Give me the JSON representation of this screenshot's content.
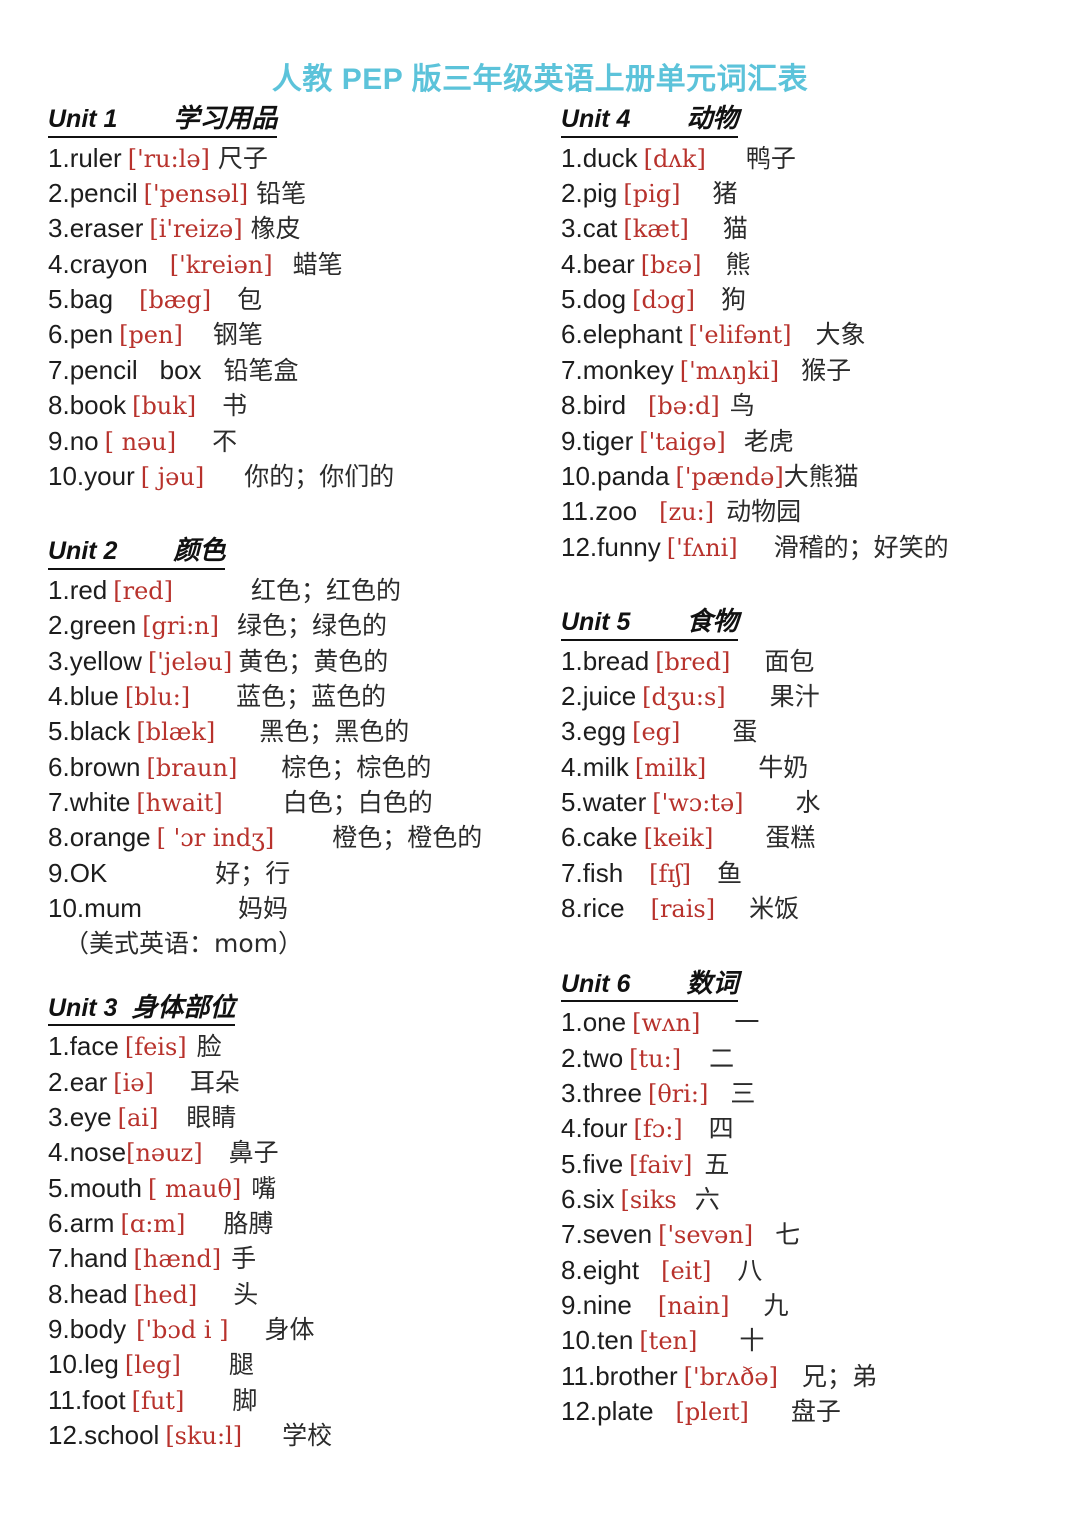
{
  "document": {
    "title": "人教 PEP 版三年级英语上册单元词汇表",
    "title_color": "#5cc3da",
    "phonetic_color": "#b8322c",
    "text_color": "#1a1a1a",
    "background": "#ffffff"
  },
  "units": [
    {
      "id": "unit-1",
      "label": "Unit 1",
      "topic": "学习用品",
      "gap": 56,
      "column": "left",
      "entries": [
        {
          "num": "1.",
          "word": "ruler",
          "gap1": 6,
          "phon": "['ru:lə]",
          "gap2": 8,
          "zh": "尺子"
        },
        {
          "num": "2.",
          "word": "pencil",
          "gap1": 6,
          "phon": "['pensəl]",
          "gap2": 8,
          "zh": "铅笔"
        },
        {
          "num": "3.",
          "word": "eraser",
          "gap1": 6,
          "phon": "[i'reizə]",
          "gap2": 8,
          "zh": "橡皮"
        },
        {
          "num": "4.",
          "word": "crayon",
          "gap1": 22,
          "phon": "['kreiən]",
          "gap2": 20,
          "zh": "蜡笔"
        },
        {
          "num": "5.",
          "word": "bag",
          "gap1": 26,
          "phon": "[bæg]",
          "gap2": 26,
          "zh": "包"
        },
        {
          "num": "6.",
          "word": "pen",
          "gap1": 6,
          "phon": "[pen]",
          "gap2": 30,
          "zh": "钢笔"
        },
        {
          "num": "7.",
          "word": "pencil",
          "gap1": 22,
          "phon": "box",
          "gap2": 22,
          "zh": "铅笔盒",
          "plain": true
        },
        {
          "num": "8.",
          "word": "book",
          "gap1": 6,
          "phon": "[buk]",
          "gap2": 26,
          "zh": "书"
        },
        {
          "num": "9.",
          "word": "no",
          "gap1": 6,
          "phon": "[ nəu]",
          "gap2": 36,
          "zh": "不"
        },
        {
          "num": "10.",
          "word": "your",
          "gap1": 6,
          "phon": "[ jəu]",
          "gap2": 40,
          "zh": "你的；你们的"
        }
      ]
    },
    {
      "id": "unit-2",
      "label": "Unit 2",
      "topic": "颜色",
      "gap": 56,
      "column": "left",
      "entries": [
        {
          "num": "1.",
          "word": "red",
          "gap1": 6,
          "phon": "[red]",
          "gap2": 78,
          "zh": "红色；红色的"
        },
        {
          "num": "2.",
          "word": "green",
          "gap1": 6,
          "phon": "[gri:n]",
          "gap2": 18,
          "zh": "绿色；绿色的"
        },
        {
          "num": "3.",
          "word": "yellow",
          "gap1": 6,
          "phon": "['jeləu]",
          "gap2": 6,
          "zh": "黄色；黄色的"
        },
        {
          "num": "4.",
          "word": "blue",
          "gap1": 6,
          "phon": "[blu:]",
          "gap2": 46,
          "zh": "蓝色；蓝色的"
        },
        {
          "num": "5.",
          "word": "black",
          "gap1": 6,
          "phon": "[blæk]",
          "gap2": 44,
          "zh": "黑色；黑色的"
        },
        {
          "num": "6.",
          "word": "brown",
          "gap1": 6,
          "phon": "[braun]",
          "gap2": 44,
          "zh": "棕色；棕色的"
        },
        {
          "num": "7.",
          "word": "white",
          "gap1": 6,
          "phon": "[hwait]",
          "gap2": 60,
          "zh": "白色；白色的"
        },
        {
          "num": "8.",
          "word": "orange",
          "gap1": 6,
          "phon": "[ 'ɔr indʒ]",
          "gap2": 58,
          "zh": "橙色；橙色的"
        },
        {
          "num": "9.",
          "word": "OK",
          "gap1": 0,
          "phon": "",
          "gap2": 108,
          "zh": "好；行"
        },
        {
          "num": "10.",
          "word": "mum",
          "gap1": 0,
          "phon": "",
          "gap2": 96,
          "zh": "妈妈"
        }
      ],
      "note": "（美式英语：mom）"
    },
    {
      "id": "unit-3",
      "label": "Unit 3",
      "topic": "身体部位",
      "gap": 14,
      "column": "left",
      "entries": [
        {
          "num": "1.",
          "word": "face",
          "gap1": 6,
          "phon": "[feis]",
          "gap2": 10,
          "zh": "脸"
        },
        {
          "num": "2.",
          "word": "ear",
          "gap1": 6,
          "phon": "[iə]",
          "gap2": 36,
          "zh": "耳朵"
        },
        {
          "num": "3.",
          "word": "eye",
          "gap1": 6,
          "phon": "[ai]",
          "gap2": 28,
          "zh": "眼睛"
        },
        {
          "num": "4.",
          "word": "nose",
          "gap1": 0,
          "phon": "[nəuz]",
          "gap2": 26,
          "zh": "鼻子"
        },
        {
          "num": "5.",
          "word": "mouth",
          "gap1": 6,
          "phon": "[ mauθ]",
          "gap2": 10,
          "zh": "嘴"
        },
        {
          "num": "6.",
          "word": "arm",
          "gap1": 6,
          "phon": "[ɑ:m]",
          "gap2": 38,
          "zh": "胳膊"
        },
        {
          "num": "7.",
          "word": "hand",
          "gap1": 6,
          "phon": "[hænd]",
          "gap2": 10,
          "zh": "手"
        },
        {
          "num": "8.",
          "word": "head",
          "gap1": 6,
          "phon": "[hed]",
          "gap2": 36,
          "zh": "头"
        },
        {
          "num": "9.",
          "word": "body",
          "gap1": 10,
          "phon": "['bɔd i ]",
          "gap2": 36,
          "zh": "身体"
        },
        {
          "num": "10.",
          "word": "leg",
          "gap1": 6,
          "phon": "[leg]",
          "gap2": 48,
          "zh": "腿"
        },
        {
          "num": "11.",
          "word": "foot",
          "gap1": 6,
          "phon": "[fut]",
          "gap2": 48,
          "zh": "脚"
        },
        {
          "num": "12.",
          "word": "school",
          "gap1": 6,
          "phon": "[sku:l]",
          "gap2": 40,
          "zh": "学校"
        }
      ]
    },
    {
      "id": "unit-4",
      "label": "Unit 4",
      "topic": "动物",
      "gap": 56,
      "column": "right",
      "entries": [
        {
          "num": "1.",
          "word": "duck",
          "gap1": 6,
          "phon": "[dʌk]",
          "gap2": 40,
          "zh": "鸭子"
        },
        {
          "num": "2.",
          "word": "pig",
          "gap1": 6,
          "phon": "[pig]",
          "gap2": 32,
          "zh": "猪"
        },
        {
          "num": "3.",
          "word": "cat",
          "gap1": 6,
          "phon": "[kæt]",
          "gap2": 34,
          "zh": "猫"
        },
        {
          "num": "4.",
          "word": "bear",
          "gap1": 6,
          "phon": "[bɛə]",
          "gap2": 24,
          "zh": "熊"
        },
        {
          "num": "5.",
          "word": "dog",
          "gap1": 6,
          "phon": "[dɔg]",
          "gap2": 26,
          "zh": "狗"
        },
        {
          "num": "6.",
          "word": "elephant",
          "gap1": 6,
          "phon": "['elifənt]",
          "gap2": 24,
          "zh": "大象"
        },
        {
          "num": "7.",
          "word": "monkey",
          "gap1": 6,
          "phon": "['mʌŋki]",
          "gap2": 22,
          "zh": "猴子"
        },
        {
          "num": "8.",
          "word": "bird",
          "gap1": 22,
          "phon": "[bə:d]",
          "gap2": 10,
          "zh": "鸟"
        },
        {
          "num": "9.",
          "word": "tiger",
          "gap1": 6,
          "phon": "['taigə]",
          "gap2": 18,
          "zh": "老虎"
        },
        {
          "num": "10.",
          "word": "panda",
          "gap1": 6,
          "phon": "['pændə]",
          "gap2": 0,
          "zh": "大熊猫"
        },
        {
          "num": "11.",
          "word": "zoo",
          "gap1": 22,
          "phon": "[zu:]",
          "gap2": 12,
          "zh": "动物园"
        },
        {
          "num": "12.",
          "word": "funny",
          "gap1": 6,
          "phon": "['fʌni]",
          "gap2": 36,
          "zh": "滑稽的；好笑的"
        }
      ]
    },
    {
      "id": "unit-5",
      "label": "Unit 5",
      "topic": "食物",
      "gap": 56,
      "column": "right",
      "entries": [
        {
          "num": "1.",
          "word": "bread",
          "gap1": 6,
          "phon": "[bred]",
          "gap2": 34,
          "zh": "面包"
        },
        {
          "num": "2.",
          "word": "juice",
          "gap1": 6,
          "phon": "[dʒu:s]",
          "gap2": 44,
          "zh": "果汁"
        },
        {
          "num": "3.",
          "word": "egg",
          "gap1": 6,
          "phon": "[eg]",
          "gap2": 52,
          "zh": "蛋"
        },
        {
          "num": "4.",
          "word": "milk",
          "gap1": 6,
          "phon": "[milk]",
          "gap2": 52,
          "zh": "牛奶"
        },
        {
          "num": "5.",
          "word": "water",
          "gap1": 6,
          "phon": "['wɔ:tə]",
          "gap2": 52,
          "zh": "水"
        },
        {
          "num": "6.",
          "word": "cake",
          "gap1": 6,
          "phon": "[keik]",
          "gap2": 52,
          "zh": "蛋糕"
        },
        {
          "num": "7.",
          "word": "fish",
          "gap1": 26,
          "phon": "[fɪʃ]",
          "gap2": 26,
          "zh": "鱼"
        },
        {
          "num": "8.",
          "word": "rice",
          "gap1": 26,
          "phon": "[rais]",
          "gap2": 34,
          "zh": "米饭"
        }
      ]
    },
    {
      "id": "unit-6",
      "label": "Unit 6",
      "topic": "数词",
      "gap": 56,
      "column": "right",
      "entries": [
        {
          "num": "1.",
          "word": "one",
          "gap1": 6,
          "phon": "[wʌn]",
          "gap2": 34,
          "zh": "一"
        },
        {
          "num": "2.",
          "word": "two",
          "gap1": 6,
          "phon": "[tu:]",
          "gap2": 28,
          "zh": "二"
        },
        {
          "num": "3.",
          "word": "three",
          "gap1": 6,
          "phon": "[θri:]",
          "gap2": 22,
          "zh": "三"
        },
        {
          "num": "4.",
          "word": "four",
          "gap1": 6,
          "phon": "[fɔ:]",
          "gap2": 26,
          "zh": "四"
        },
        {
          "num": "5.",
          "word": "five",
          "gap1": 6,
          "phon": "[faiv]",
          "gap2": 12,
          "zh": "五"
        },
        {
          "num": "6.",
          "word": "six",
          "gap1": 6,
          "phon": "[siks",
          "gap2": 18,
          "zh": "六"
        },
        {
          "num": "7.",
          "word": "seven",
          "gap1": 6,
          "phon": "['sevən]",
          "gap2": 22,
          "zh": "七"
        },
        {
          "num": "8.",
          "word": "eight",
          "gap1": 22,
          "phon": "[eit]",
          "gap2": 26,
          "zh": "八"
        },
        {
          "num": "9.",
          "word": "nine",
          "gap1": 26,
          "phon": "[nain]",
          "gap2": 34,
          "zh": "九"
        },
        {
          "num": "10.",
          "word": "ten",
          "gap1": 6,
          "phon": "[ten]",
          "gap2": 42,
          "zh": "十"
        },
        {
          "num": "11.",
          "word": "brother",
          "gap1": 6,
          "phon": "['brʌðə]",
          "gap2": 24,
          "zh": "兄；弟"
        },
        {
          "num": "12.",
          "word": "plate",
          "gap1": 22,
          "phon": "[pleɪt]",
          "gap2": 42,
          "zh": "盘子"
        }
      ]
    }
  ]
}
